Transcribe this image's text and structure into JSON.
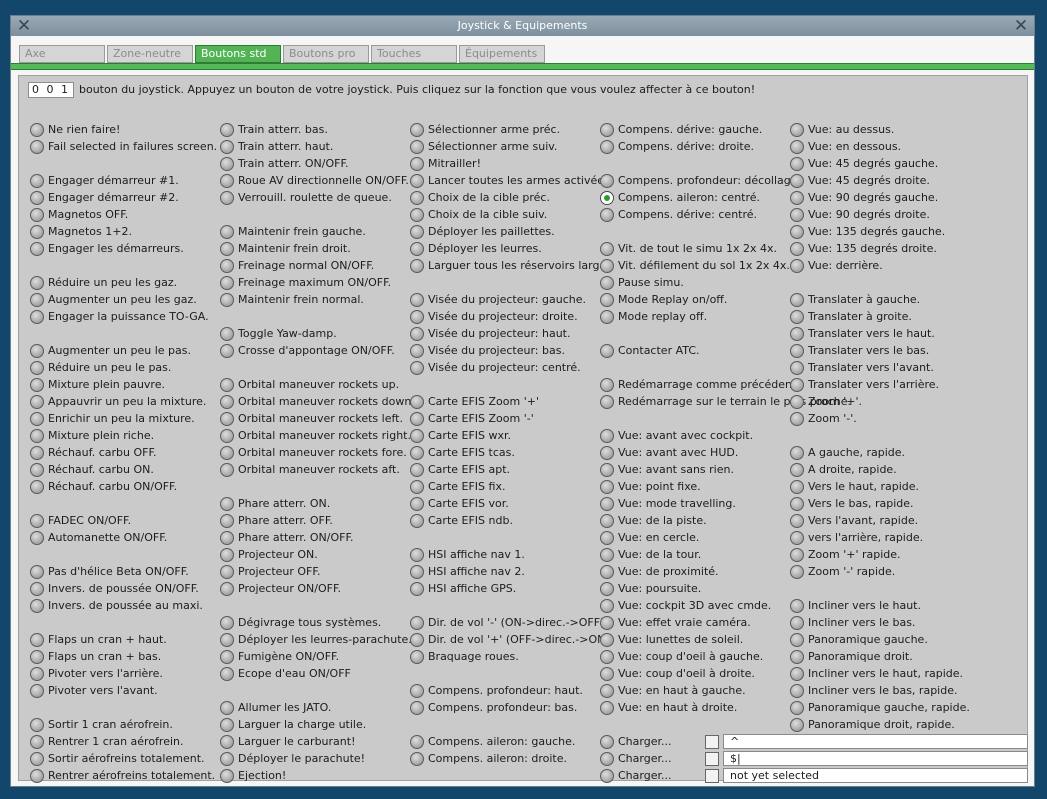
{
  "window": {
    "title": "Joystick & Equipements",
    "close_glyph": "✕"
  },
  "tabs": [
    "Axe",
    "Zone-neutre",
    "Boutons std",
    "Boutons pro",
    "Touches",
    "Équipements"
  ],
  "active_tab": "Boutons std",
  "header": {
    "button_number": "0 0 1",
    "instruction": "bouton du joystick. Appuyez un bouton de votre joystick. Puis cliquez sur la fonction que vous voulez affecter à ce bouton!"
  },
  "selected_function": "Compens. aileron: centré.",
  "columns": [
    [
      {
        "r": 0,
        "t": "Ne rien faire!"
      },
      {
        "r": 1,
        "t": "Fail selected in failures screen."
      },
      {
        "r": 3,
        "t": "Engager démarreur #1."
      },
      {
        "r": 4,
        "t": "Engager démarreur #2."
      },
      {
        "r": 5,
        "t": "Magnetos OFF."
      },
      {
        "r": 6,
        "t": "Magnetos 1+2."
      },
      {
        "r": 7,
        "t": "Engager les démarreurs."
      },
      {
        "r": 9,
        "t": "Réduire un peu les gaz."
      },
      {
        "r": 10,
        "t": "Augmenter un peu les gaz."
      },
      {
        "r": 11,
        "t": "Engager la puissance TO-GA."
      },
      {
        "r": 13,
        "t": "Augmenter un peu le pas."
      },
      {
        "r": 14,
        "t": "Réduire un peu le pas."
      },
      {
        "r": 15,
        "t": "Mixture plein pauvre."
      },
      {
        "r": 16,
        "t": "Appauvrir un peu la mixture."
      },
      {
        "r": 17,
        "t": "Enrichir un peu la mixture."
      },
      {
        "r": 18,
        "t": "Mixture plein riche."
      },
      {
        "r": 19,
        "t": "Réchauf. carbu OFF."
      },
      {
        "r": 20,
        "t": "Réchauf. carbu ON."
      },
      {
        "r": 21,
        "t": "Réchauf. carbu ON/OFF."
      },
      {
        "r": 23,
        "t": "FADEC ON/OFF."
      },
      {
        "r": 24,
        "t": "Automanette ON/OFF."
      },
      {
        "r": 26,
        "t": "Pas d'hélice Beta ON/OFF."
      },
      {
        "r": 27,
        "t": "Invers. de poussée ON/OFF."
      },
      {
        "r": 28,
        "t": "Invers. de poussée au maxi."
      },
      {
        "r": 30,
        "t": "Flaps un cran + haut."
      },
      {
        "r": 31,
        "t": "Flaps un cran + bas."
      },
      {
        "r": 32,
        "t": "Pivoter vers l'arrière."
      },
      {
        "r": 33,
        "t": "Pivoter vers l'avant."
      },
      {
        "r": 35,
        "t": "Sortir 1 cran aérofrein."
      },
      {
        "r": 36,
        "t": "Rentrer 1 cran aérofrein."
      },
      {
        "r": 37,
        "t": "Sortir aérofreins totalement."
      },
      {
        "r": 38,
        "t": "Rentrer aérofreins totalement."
      }
    ],
    [
      {
        "r": 0,
        "t": "Train atterr. bas."
      },
      {
        "r": 1,
        "t": "Train atterr. haut."
      },
      {
        "r": 2,
        "t": "Train atterr. ON/OFF."
      },
      {
        "r": 3,
        "t": "Roue AV directionnelle ON/OFF."
      },
      {
        "r": 4,
        "t": "Verrouill. roulette de queue."
      },
      {
        "r": 6,
        "t": "Maintenir frein gauche."
      },
      {
        "r": 7,
        "t": "Maintenir frein droit."
      },
      {
        "r": 8,
        "t": "Freinage normal ON/OFF."
      },
      {
        "r": 9,
        "t": "Freinage maximum ON/OFF."
      },
      {
        "r": 10,
        "t": "Maintenir frein normal."
      },
      {
        "r": 12,
        "t": "Toggle Yaw-damp."
      },
      {
        "r": 13,
        "t": "Crosse d'appontage ON/OFF."
      },
      {
        "r": 15,
        "t": "Orbital maneuver rockets up."
      },
      {
        "r": 16,
        "t": "Orbital maneuver rockets down."
      },
      {
        "r": 17,
        "t": "Orbital maneuver rockets left."
      },
      {
        "r": 18,
        "t": "Orbital maneuver rockets right."
      },
      {
        "r": 19,
        "t": "Orbital maneuver rockets fore."
      },
      {
        "r": 20,
        "t": "Orbital maneuver rockets aft."
      },
      {
        "r": 22,
        "t": "Phare atterr. ON."
      },
      {
        "r": 23,
        "t": "Phare atterr. OFF."
      },
      {
        "r": 24,
        "t": "Phare atterr. ON/OFF."
      },
      {
        "r": 25,
        "t": "Projecteur ON."
      },
      {
        "r": 26,
        "t": "Projecteur OFF."
      },
      {
        "r": 27,
        "t": "Projecteur ON/OFF."
      },
      {
        "r": 29,
        "t": "Dégivrage tous systèmes."
      },
      {
        "r": 30,
        "t": "Déployer les leurres-parachute."
      },
      {
        "r": 31,
        "t": "Fumigène ON/OFF."
      },
      {
        "r": 32,
        "t": "Ecope d'eau ON/OFF"
      },
      {
        "r": 34,
        "t": "Allumer les JATO."
      },
      {
        "r": 35,
        "t": "Larguer la charge utile."
      },
      {
        "r": 36,
        "t": "Larguer le carburant!"
      },
      {
        "r": 37,
        "t": "Déployer le parachute!"
      },
      {
        "r": 38,
        "t": "Ejection!"
      }
    ],
    [
      {
        "r": 0,
        "t": "Sélectionner arme préc."
      },
      {
        "r": 1,
        "t": "Sélectionner arme suiv."
      },
      {
        "r": 2,
        "t": "Mitrailler!"
      },
      {
        "r": 3,
        "t": "Lancer toutes les armes activées!"
      },
      {
        "r": 4,
        "t": "Choix de la cible préc."
      },
      {
        "r": 5,
        "t": "Choix de la cible suiv."
      },
      {
        "r": 6,
        "t": "Déployer les paillettes."
      },
      {
        "r": 7,
        "t": "Déployer les leurres."
      },
      {
        "r": 8,
        "t": "Larguer tous les réservoirs largab"
      },
      {
        "r": 10,
        "t": "Visée du projecteur: gauche."
      },
      {
        "r": 11,
        "t": "Visée du projecteur: droite."
      },
      {
        "r": 12,
        "t": "Visée du projecteur: haut."
      },
      {
        "r": 13,
        "t": "Visée du projecteur: bas."
      },
      {
        "r": 14,
        "t": "Visée du projecteur: centré."
      },
      {
        "r": 16,
        "t": "Carte EFIS Zoom '+'"
      },
      {
        "r": 17,
        "t": "Carte EFIS Zoom '-'"
      },
      {
        "r": 18,
        "t": "Carte EFIS wxr."
      },
      {
        "r": 19,
        "t": "Carte EFIS tcas."
      },
      {
        "r": 20,
        "t": "Carte EFIS apt."
      },
      {
        "r": 21,
        "t": "Carte EFIS fix."
      },
      {
        "r": 22,
        "t": "Carte EFIS vor."
      },
      {
        "r": 23,
        "t": "Carte EFIS ndb."
      },
      {
        "r": 25,
        "t": "HSI affiche nav 1."
      },
      {
        "r": 26,
        "t": "HSI affiche nav 2."
      },
      {
        "r": 27,
        "t": "HSI affiche GPS."
      },
      {
        "r": 29,
        "t": "Dir. de vol '-' (ON->direc.->OFF)."
      },
      {
        "r": 30,
        "t": "Dir. de vol '+' (OFF->direc.->ON)"
      },
      {
        "r": 31,
        "t": "Braquage roues."
      },
      {
        "r": 33,
        "t": "Compens. profondeur: haut."
      },
      {
        "r": 34,
        "t": "Compens. profondeur: bas."
      },
      {
        "r": 36,
        "t": "Compens. aileron: gauche."
      },
      {
        "r": 37,
        "t": "Compens. aileron: droite."
      }
    ],
    [
      {
        "r": 0,
        "t": "Compens. dérive: gauche."
      },
      {
        "r": 1,
        "t": "Compens. dérive: droite."
      },
      {
        "r": 3,
        "t": "Compens. profondeur: décollage."
      },
      {
        "r": 4,
        "t": "Compens. aileron: centré."
      },
      {
        "r": 5,
        "t": "Compens. dérive: centré."
      },
      {
        "r": 7,
        "t": "Vit. de tout le simu 1x 2x 4x."
      },
      {
        "r": 8,
        "t": "Vit. défilement du sol 1x 2x 4x."
      },
      {
        "r": 9,
        "t": "Pause simu."
      },
      {
        "r": 10,
        "t": "Mode Replay on/off."
      },
      {
        "r": 11,
        "t": "Mode replay off."
      },
      {
        "r": 13,
        "t": "Contacter ATC."
      },
      {
        "r": 15,
        "t": "Redémarrage comme précédent"
      },
      {
        "r": 16,
        "t": "Redémarrage sur le terrain le plus proche."
      },
      {
        "r": 18,
        "t": "Vue: avant avec cockpit."
      },
      {
        "r": 19,
        "t": "Vue: avant avec HUD."
      },
      {
        "r": 20,
        "t": "Vue: avant sans rien."
      },
      {
        "r": 21,
        "t": "Vue: point fixe."
      },
      {
        "r": 22,
        "t": "Vue: mode travelling."
      },
      {
        "r": 23,
        "t": "Vue: de la piste."
      },
      {
        "r": 24,
        "t": "Vue: en cercle."
      },
      {
        "r": 25,
        "t": "Vue: de la tour."
      },
      {
        "r": 26,
        "t": "Vue: de proximité."
      },
      {
        "r": 27,
        "t": "Vue: poursuite."
      },
      {
        "r": 28,
        "t": "Vue: cockpit 3D avec cmde."
      },
      {
        "r": 29,
        "t": "Vue: effet vraie caméra."
      },
      {
        "r": 30,
        "t": "Vue: lunettes de soleil."
      },
      {
        "r": 31,
        "t": "Vue: coup d'oeil à gauche."
      },
      {
        "r": 32,
        "t": "Vue: coup d'oeil à droite."
      },
      {
        "r": 33,
        "t": "Vue: en haut à gauche."
      },
      {
        "r": 34,
        "t": "Vue: en haut à droite."
      },
      {
        "r": 36,
        "t": "Charger..."
      },
      {
        "r": 37,
        "t": "Charger..."
      },
      {
        "r": 38,
        "t": "Charger..."
      }
    ],
    [
      {
        "r": 0,
        "t": "Vue: au dessus."
      },
      {
        "r": 1,
        "t": "Vue: en dessous."
      },
      {
        "r": 2,
        "t": "Vue: 45 degrés gauche."
      },
      {
        "r": 3,
        "t": "Vue: 45 degrés droite."
      },
      {
        "r": 4,
        "t": "Vue: 90 degrés gauche."
      },
      {
        "r": 5,
        "t": "Vue: 90 degrés droite."
      },
      {
        "r": 6,
        "t": "Vue: 135 degrés gauche."
      },
      {
        "r": 7,
        "t": "Vue: 135 degrés droite."
      },
      {
        "r": 8,
        "t": "Vue: derrière."
      },
      {
        "r": 10,
        "t": "Translater à gauche."
      },
      {
        "r": 11,
        "t": "Translater à groite."
      },
      {
        "r": 12,
        "t": "Translater vers le haut."
      },
      {
        "r": 13,
        "t": "Translater vers le bas."
      },
      {
        "r": 14,
        "t": "Translater vers l'avant."
      },
      {
        "r": 15,
        "t": "Translater vers l'arrière."
      },
      {
        "r": 16,
        "t": "Zoom '+'."
      },
      {
        "r": 17,
        "t": "Zoom '-'."
      },
      {
        "r": 19,
        "t": "A gauche, rapide."
      },
      {
        "r": 20,
        "t": "A droite, rapide."
      },
      {
        "r": 21,
        "t": "Vers le haut, rapide."
      },
      {
        "r": 22,
        "t": "Vers le bas, rapide."
      },
      {
        "r": 23,
        "t": "Vers l'avant, rapide."
      },
      {
        "r": 24,
        "t": "vers l'arrière, rapide."
      },
      {
        "r": 25,
        "t": "Zoom '+' rapide."
      },
      {
        "r": 26,
        "t": "Zoom '-' rapide."
      },
      {
        "r": 28,
        "t": "Incliner vers le haut."
      },
      {
        "r": 29,
        "t": "Incliner vers le bas."
      },
      {
        "r": 30,
        "t": "Panoramique gauche."
      },
      {
        "r": 31,
        "t": "Panoramique droit."
      },
      {
        "r": 32,
        "t": "Incliner vers le haut, rapide."
      },
      {
        "r": 33,
        "t": "Incliner vers le bas, rapide."
      },
      {
        "r": 34,
        "t": "Panoramique gauche, rapide."
      },
      {
        "r": 35,
        "t": "Panoramique droit, rapide."
      }
    ]
  ],
  "load_slots": [
    {
      "r": 36,
      "value": "^"
    },
    {
      "r": 37,
      "value": "$|"
    },
    {
      "r": 38,
      "value": "not yet selected"
    }
  ]
}
